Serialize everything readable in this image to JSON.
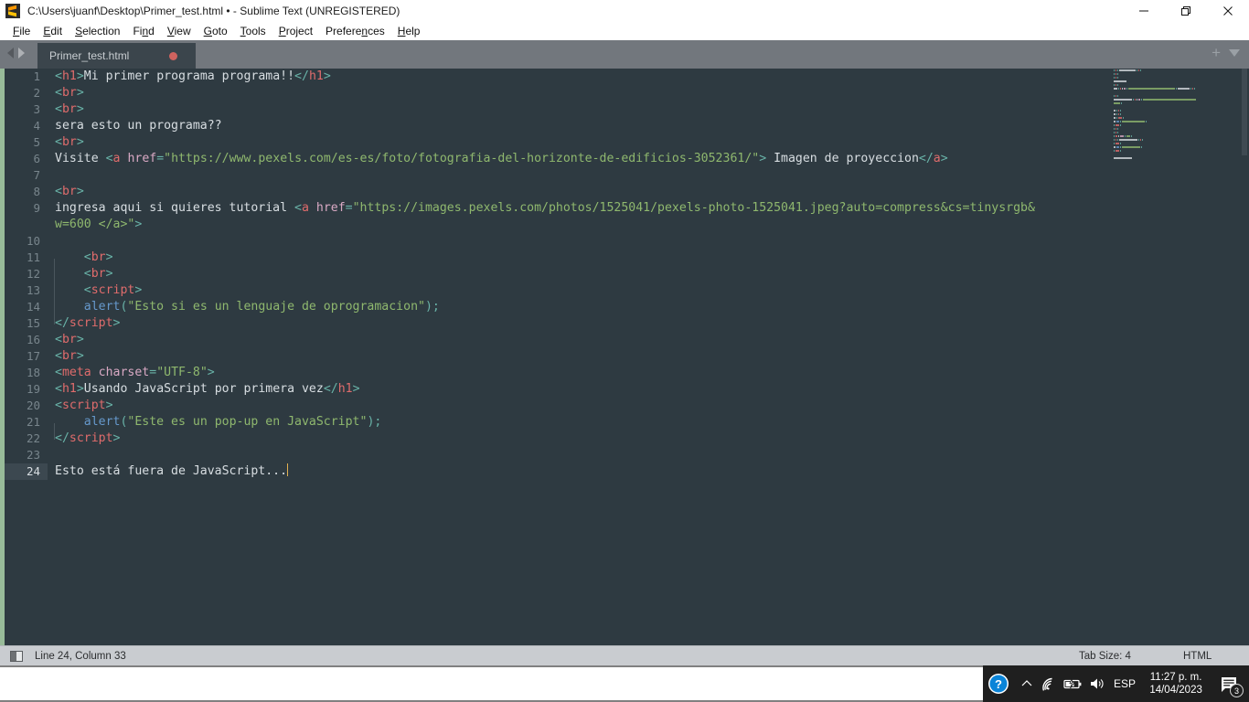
{
  "window": {
    "title": "C:\\Users\\juanf\\Desktop\\Primer_test.html • - Sublime Text (UNREGISTERED)",
    "app_icon": "sublime-text-icon",
    "controls": {
      "minimize": "minimize-icon",
      "restore": "restore-icon",
      "close": "close-icon"
    }
  },
  "menubar": {
    "items": [
      {
        "label": "File",
        "mnemonic": "F"
      },
      {
        "label": "Edit",
        "mnemonic": "E"
      },
      {
        "label": "Selection",
        "mnemonic": "S"
      },
      {
        "label": "Find",
        "mnemonic": "n"
      },
      {
        "label": "View",
        "mnemonic": "V"
      },
      {
        "label": "Goto",
        "mnemonic": "G"
      },
      {
        "label": "Tools",
        "mnemonic": "T"
      },
      {
        "label": "Project",
        "mnemonic": "P"
      },
      {
        "label": "Preferences",
        "mnemonic": "n"
      },
      {
        "label": "Help",
        "mnemonic": "H"
      }
    ]
  },
  "tabbar": {
    "prev_icon": "arrow-left-icon",
    "next_icon": "arrow-right-icon",
    "tabs": [
      {
        "label": "Primer_test.html",
        "dirty": true
      }
    ],
    "new_tab_icon": "plus-icon",
    "tab_menu_icon": "chevron-down-icon"
  },
  "editor": {
    "line_count": 24,
    "active_line": 24,
    "caret_column": 33,
    "colors": {
      "background": "#2e3a41",
      "gutter_text": "#78858c",
      "active_gutter_bg": "#3c4850",
      "fold_strip": "#98bb99",
      "tag": "#e06c6c",
      "punct": "#69b3a8",
      "attr": "#d9a9c4",
      "string": "#8fb86e",
      "text": "#d8dee2",
      "function": "#6699cc",
      "caret": "#e0b050"
    },
    "lines": [
      {
        "n": 1,
        "tokens": [
          {
            "t": "punct",
            "v": "<"
          },
          {
            "t": "tag",
            "v": "h1"
          },
          {
            "t": "punct",
            "v": ">"
          },
          {
            "t": "text",
            "v": "Mi primer programa programa!!"
          },
          {
            "t": "punct",
            "v": "</"
          },
          {
            "t": "tag",
            "v": "h1"
          },
          {
            "t": "punct",
            "v": ">"
          }
        ]
      },
      {
        "n": 2,
        "tokens": [
          {
            "t": "punct",
            "v": "<"
          },
          {
            "t": "tag",
            "v": "br"
          },
          {
            "t": "punct",
            "v": ">"
          }
        ]
      },
      {
        "n": 3,
        "tokens": [
          {
            "t": "punct",
            "v": "<"
          },
          {
            "t": "tag",
            "v": "br"
          },
          {
            "t": "punct",
            "v": ">"
          }
        ]
      },
      {
        "n": 4,
        "tokens": [
          {
            "t": "text",
            "v": "sera esto un programa??"
          }
        ]
      },
      {
        "n": 5,
        "tokens": [
          {
            "t": "punct",
            "v": "<"
          },
          {
            "t": "tag",
            "v": "br"
          },
          {
            "t": "punct",
            "v": ">"
          }
        ]
      },
      {
        "n": 6,
        "tokens": [
          {
            "t": "text",
            "v": "Visite "
          },
          {
            "t": "punct",
            "v": "<"
          },
          {
            "t": "tag",
            "v": "a"
          },
          {
            "t": "text",
            "v": " "
          },
          {
            "t": "attr",
            "v": "href"
          },
          {
            "t": "punct",
            "v": "="
          },
          {
            "t": "str",
            "v": "\"https://www.pexels.com/es-es/foto/fotografia-del-horizonte-de-edificios-3052361/\""
          },
          {
            "t": "punct",
            "v": ">"
          },
          {
            "t": "text",
            "v": " Imagen de proyeccion"
          },
          {
            "t": "punct",
            "v": "</"
          },
          {
            "t": "tag",
            "v": "a"
          },
          {
            "t": "punct",
            "v": ">"
          }
        ]
      },
      {
        "n": 7,
        "tokens": []
      },
      {
        "n": 8,
        "tokens": [
          {
            "t": "punct",
            "v": "<"
          },
          {
            "t": "tag",
            "v": "br"
          },
          {
            "t": "punct",
            "v": ">"
          }
        ]
      },
      {
        "n": 9,
        "tokens": [
          {
            "t": "text",
            "v": "ingresa aqui si quieres tutorial "
          },
          {
            "t": "punct",
            "v": "<"
          },
          {
            "t": "tag",
            "v": "a"
          },
          {
            "t": "text",
            "v": " "
          },
          {
            "t": "attr",
            "v": "href"
          },
          {
            "t": "punct",
            "v": "="
          },
          {
            "t": "str",
            "v": "\"https://images.pexels.com/photos/1525041/pexels-photo-1525041.jpeg?auto=compress&cs=tinysrgb&"
          }
        ],
        "wrap": [
          {
            "t": "str",
            "v": "w=600 </a>\""
          },
          {
            "t": "punct",
            "v": ">"
          }
        ]
      },
      {
        "n": 10,
        "tokens": []
      },
      {
        "n": 11,
        "tokens": [
          {
            "t": "text",
            "v": "    "
          },
          {
            "t": "punct",
            "v": "<"
          },
          {
            "t": "tag",
            "v": "br"
          },
          {
            "t": "punct",
            "v": ">"
          }
        ]
      },
      {
        "n": 12,
        "tokens": [
          {
            "t": "text",
            "v": "    "
          },
          {
            "t": "punct",
            "v": "<"
          },
          {
            "t": "tag",
            "v": "br"
          },
          {
            "t": "punct",
            "v": ">"
          }
        ]
      },
      {
        "n": 13,
        "tokens": [
          {
            "t": "text",
            "v": "    "
          },
          {
            "t": "punct",
            "v": "<"
          },
          {
            "t": "tag",
            "v": "script"
          },
          {
            "t": "punct",
            "v": ">"
          }
        ]
      },
      {
        "n": 14,
        "tokens": [
          {
            "t": "text",
            "v": "    "
          },
          {
            "t": "fn",
            "v": "alert"
          },
          {
            "t": "punct",
            "v": "("
          },
          {
            "t": "str",
            "v": "\"Esto si es un lenguaje de oprogramacion\""
          },
          {
            "t": "punct",
            "v": ");"
          }
        ]
      },
      {
        "n": 15,
        "tokens": [
          {
            "t": "punct",
            "v": "</"
          },
          {
            "t": "tag",
            "v": "script"
          },
          {
            "t": "punct",
            "v": ">"
          }
        ]
      },
      {
        "n": 16,
        "tokens": [
          {
            "t": "punct",
            "v": "<"
          },
          {
            "t": "tag",
            "v": "br"
          },
          {
            "t": "punct",
            "v": ">"
          }
        ]
      },
      {
        "n": 17,
        "tokens": [
          {
            "t": "punct",
            "v": "<"
          },
          {
            "t": "tag",
            "v": "br"
          },
          {
            "t": "punct",
            "v": ">"
          }
        ]
      },
      {
        "n": 18,
        "tokens": [
          {
            "t": "punct",
            "v": "<"
          },
          {
            "t": "tag",
            "v": "meta"
          },
          {
            "t": "text",
            "v": " "
          },
          {
            "t": "attr",
            "v": "charset"
          },
          {
            "t": "punct",
            "v": "="
          },
          {
            "t": "str",
            "v": "\"UTF-8\""
          },
          {
            "t": "punct",
            "v": ">"
          }
        ]
      },
      {
        "n": 19,
        "tokens": [
          {
            "t": "punct",
            "v": "<"
          },
          {
            "t": "tag",
            "v": "h1"
          },
          {
            "t": "punct",
            "v": ">"
          },
          {
            "t": "text",
            "v": "Usando JavaScript por primera vez"
          },
          {
            "t": "punct",
            "v": "</"
          },
          {
            "t": "tag",
            "v": "h1"
          },
          {
            "t": "punct",
            "v": ">"
          }
        ]
      },
      {
        "n": 20,
        "tokens": [
          {
            "t": "punct",
            "v": "<"
          },
          {
            "t": "tag",
            "v": "script"
          },
          {
            "t": "punct",
            "v": ">"
          }
        ]
      },
      {
        "n": 21,
        "tokens": [
          {
            "t": "text",
            "v": "    "
          },
          {
            "t": "fn",
            "v": "alert"
          },
          {
            "t": "punct",
            "v": "("
          },
          {
            "t": "str",
            "v": "\"Este es un pop-up en JavaScript\""
          },
          {
            "t": "punct",
            "v": ");"
          }
        ]
      },
      {
        "n": 22,
        "tokens": [
          {
            "t": "punct",
            "v": "</"
          },
          {
            "t": "tag",
            "v": "script"
          },
          {
            "t": "punct",
            "v": ">"
          }
        ]
      },
      {
        "n": 23,
        "tokens": []
      },
      {
        "n": 24,
        "tokens": [
          {
            "t": "text",
            "v": "Esto está fuera de JavaScript..."
          }
        ],
        "caret": true
      }
    ]
  },
  "statusbar": {
    "sidebar_toggle_icon": "sidebar-toggle-icon",
    "position": "Line 24, Column 33",
    "tab_size": "Tab Size: 4",
    "syntax": "HTML"
  },
  "taskbar": {
    "tray": {
      "help_icon": "help-circle-icon",
      "overflow_icon": "chevron-up-icon",
      "wifi_icon": "wifi-icon",
      "battery_icon": "battery-charging-icon",
      "volume_icon": "speaker-icon",
      "language": "ESP",
      "time": "11:27 p. m.",
      "date": "14/04/2023",
      "notifications_icon": "notification-icon",
      "notifications_count": "3"
    }
  }
}
